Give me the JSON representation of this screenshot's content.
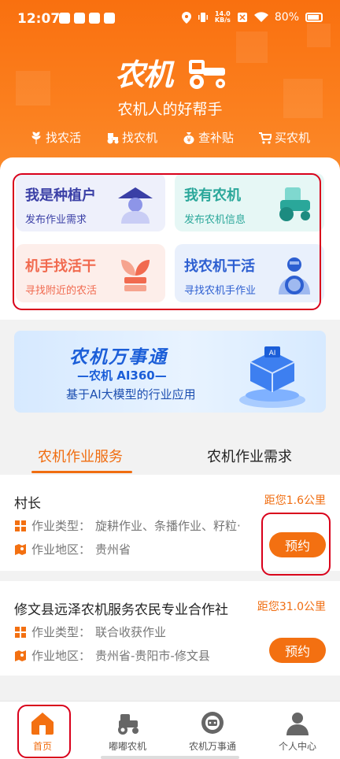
{
  "status_bar": {
    "time": "12:07",
    "speed_value": "14.0",
    "speed_unit": "KB/s",
    "battery": "80%"
  },
  "header": {
    "logo_text": "农机",
    "slogan": "农机人的好帮手"
  },
  "quick_nav": [
    {
      "label": "找农活",
      "icon": "wheat-icon"
    },
    {
      "label": "找农机",
      "icon": "tractor-icon"
    },
    {
      "label": "查补贴",
      "icon": "money-bag-icon"
    },
    {
      "label": "买农机",
      "icon": "cart-icon"
    }
  ],
  "tiles": [
    {
      "title": "我是种植户",
      "subtitle": "发布作业需求",
      "color": "#3a3fa6",
      "bg": "#eef0fb"
    },
    {
      "title": "我有农机",
      "subtitle": "发布农机信息",
      "color": "#2aa79a",
      "bg": "#e6f7f5"
    },
    {
      "title": "机手找活干",
      "subtitle": "寻找附近的农活",
      "color": "#f16a4f",
      "bg": "#fdeeea"
    },
    {
      "title": "找农机干活",
      "subtitle": "寻找农机手作业",
      "color": "#2d5fd1",
      "bg": "#e9f0fc"
    }
  ],
  "banner": {
    "title": "农机万事通",
    "subtitle": "—农机 AI360—",
    "caption": "基于AI大模型的行业应用"
  },
  "tabs": {
    "active": "农机作业服务",
    "inactive": "农机作业需求"
  },
  "services": [
    {
      "name": "村长",
      "distance": "距您1.6公里",
      "type_label": "作业类型：",
      "type_value": "旋耕作业、条播作业、籽粒·",
      "area_label": "作业地区：",
      "area_value": "贵州省",
      "button": "预约"
    },
    {
      "name": "修文县远泽农机服务农民专业合作社",
      "distance": "距您31.0公里",
      "type_label": "作业类型：",
      "type_value": "联合收获作业",
      "area_label": "作业地区：",
      "area_value": "贵州省-贵阳市-修文县",
      "button": "预约"
    }
  ],
  "bottom_nav": [
    {
      "label": "首页",
      "active": true
    },
    {
      "label": "嘟嘟农机",
      "active": false
    },
    {
      "label": "农机万事通",
      "active": false
    },
    {
      "label": "个人中心",
      "active": false
    }
  ],
  "colors": {
    "brand": "#f37011",
    "highlight_box": "#d9001b"
  }
}
